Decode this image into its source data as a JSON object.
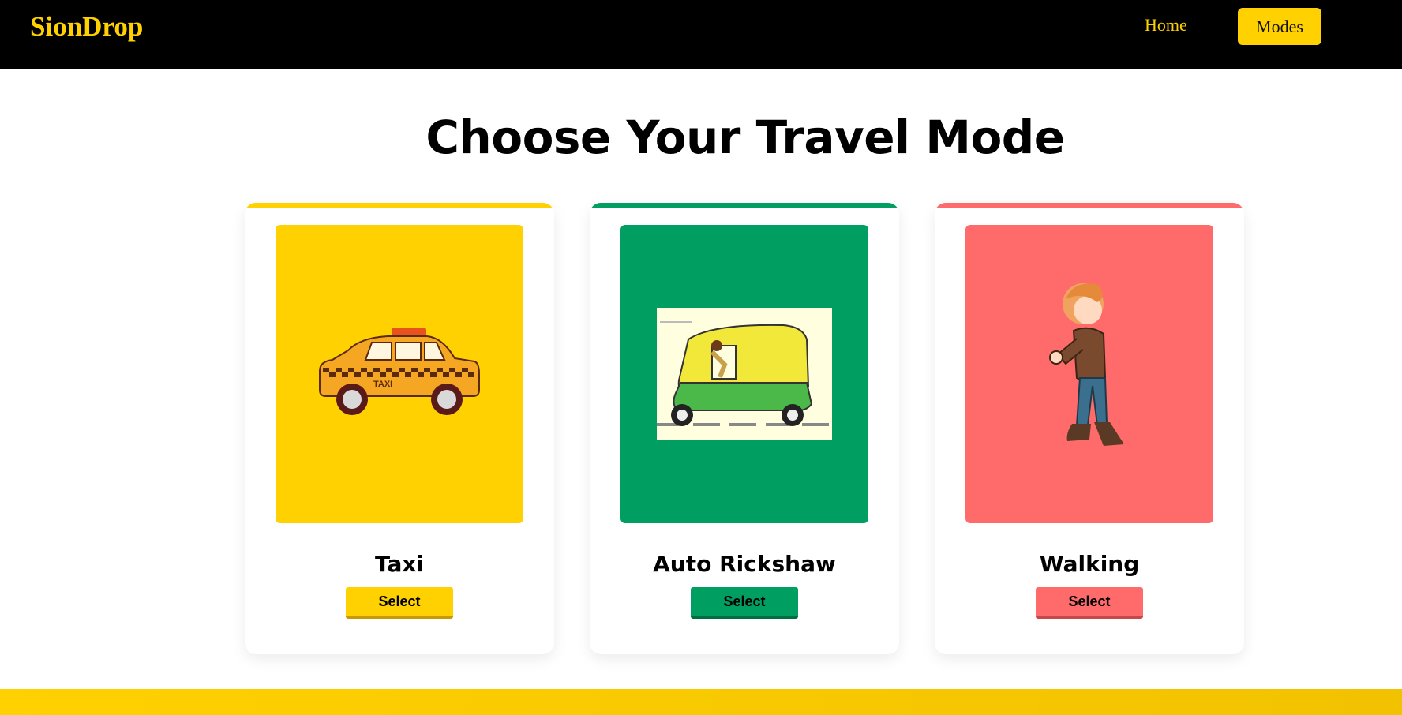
{
  "nav": {
    "brand": "SionDrop",
    "links": [
      {
        "label": "Home"
      },
      {
        "label": "Modes"
      }
    ]
  },
  "main": {
    "title": "Choose Your Travel Mode"
  },
  "modes": [
    {
      "name": "Taxi",
      "button": "Select",
      "accent": "#ffd100",
      "icon": "taxi-illustration"
    },
    {
      "name": "Auto Rickshaw",
      "button": "Select",
      "accent": "#009e60",
      "icon": "auto-rickshaw-illustration"
    },
    {
      "name": "Walking",
      "button": "Select",
      "accent": "#ff6b6b",
      "icon": "walking-person-illustration"
    }
  ]
}
